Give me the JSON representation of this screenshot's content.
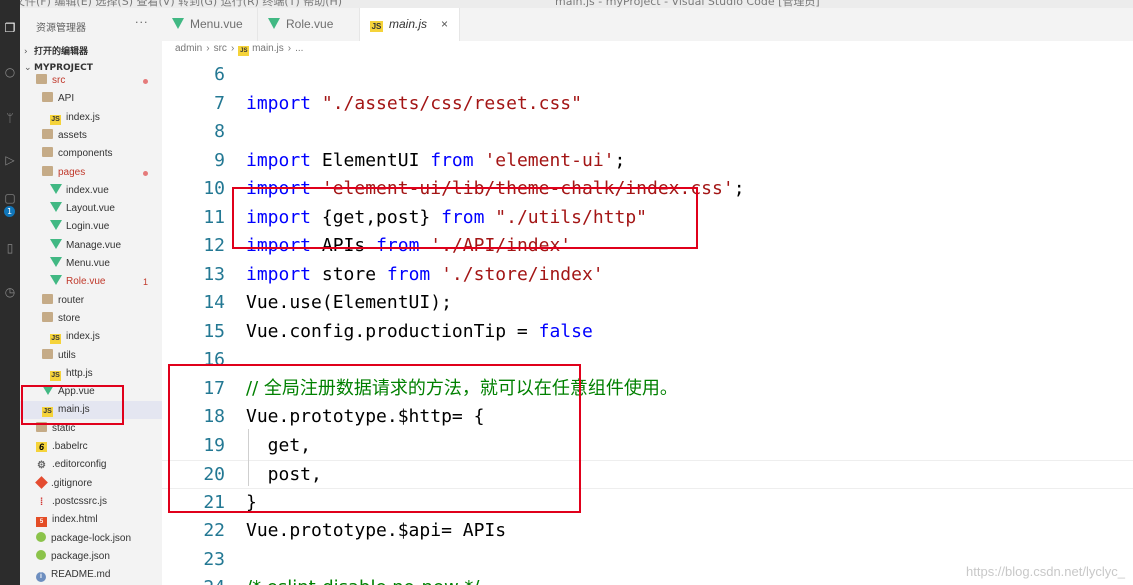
{
  "titlebar": {
    "menu_cut": "文件(F)  编辑(E)  选择(S)  查看(V)  转到(G)  运行(R)  终端(T)  帮助(H)",
    "window_title_cut": "main.js - myProject - Visual Studio Code [管理员]"
  },
  "activity_bar": {
    "icons": [
      "files-icon",
      "search-icon",
      "source-control-icon",
      "run-icon",
      "extensions-icon",
      "remote-icon",
      "timeline-icon"
    ],
    "badge": "1"
  },
  "sidebar": {
    "title": "资源管理器",
    "more": "···",
    "open_editors": "打开的编辑器",
    "project": "MYPROJECT",
    "items": [
      {
        "label": "src",
        "icon": "folder",
        "modified": true,
        "error": true
      },
      {
        "label": "API",
        "icon": "folder"
      },
      {
        "label": "index.js",
        "icon": "js"
      },
      {
        "label": "assets",
        "icon": "folder"
      },
      {
        "label": "components",
        "icon": "folder"
      },
      {
        "label": "pages",
        "icon": "folder",
        "modified": true,
        "error": true
      },
      {
        "label": "index.vue",
        "icon": "vue"
      },
      {
        "label": "Layout.vue",
        "icon": "vue"
      },
      {
        "label": "Login.vue",
        "icon": "vue"
      },
      {
        "label": "Manage.vue",
        "icon": "vue"
      },
      {
        "label": "Menu.vue",
        "icon": "vue"
      },
      {
        "label": "Role.vue",
        "icon": "vue",
        "error": true,
        "count": "1"
      },
      {
        "label": "router",
        "icon": "folder"
      },
      {
        "label": "store",
        "icon": "folder"
      },
      {
        "label": "index.js",
        "icon": "js"
      },
      {
        "label": "utils",
        "icon": "folder"
      },
      {
        "label": "http.js",
        "icon": "js"
      },
      {
        "label": "App.vue",
        "icon": "vue"
      },
      {
        "label": "main.js",
        "icon": "js",
        "active": true
      },
      {
        "label": "static",
        "icon": "folder"
      },
      {
        "label": ".babelrc",
        "icon": "babel"
      },
      {
        "label": ".editorconfig",
        "icon": "cfg"
      },
      {
        "label": ".gitignore",
        "icon": "git"
      },
      {
        "label": ".postcssrc.js",
        "icon": "post"
      },
      {
        "label": "index.html",
        "icon": "html"
      },
      {
        "label": "package-lock.json",
        "icon": "npm"
      },
      {
        "label": "package.json",
        "icon": "npm"
      },
      {
        "label": "README.md",
        "icon": "info"
      }
    ]
  },
  "tabs": [
    {
      "label": "Menu.vue",
      "icon": "vue",
      "active": false
    },
    {
      "label": "Role.vue",
      "icon": "vue",
      "active": false
    },
    {
      "label": "main.js",
      "icon": "js",
      "active": true,
      "close": "×"
    }
  ],
  "breadcrumb": {
    "parts": [
      "admin",
      "src",
      "main.js",
      "..."
    ]
  },
  "editor": {
    "lines": [
      {
        "n": "6",
        "html": ""
      },
      {
        "n": "7",
        "html": "<span class='kw'>import</span> <span class='str'>\"./assets/css/reset.css\"</span>"
      },
      {
        "n": "8",
        "html": ""
      },
      {
        "n": "9",
        "html": "<span class='kw'>import</span> ElementUI <span class='kw'>from</span> <span class='str'>'element-ui'</span>;"
      },
      {
        "n": "10",
        "html": "<span class='kw'>import</span> <span class='str'>'element-ui/lib/theme-chalk/index.css'</span>;"
      },
      {
        "n": "11",
        "html": "<span class='kw'>import</span> {get,post} <span class='kw'>from</span> <span class='str'>\"./utils/http\"</span>"
      },
      {
        "n": "12",
        "html": "<span class='kw'>import</span> APIs <span class='kw'>from</span> <span class='str'>'./API/index'</span>"
      },
      {
        "n": "13",
        "html": "<span class='kw'>import</span> store <span class='kw'>from</span> <span class='str'>'./store/index'</span>"
      },
      {
        "n": "14",
        "html": "Vue.use(ElementUI);"
      },
      {
        "n": "15",
        "html": "Vue.config.productionTip = <span class='bool'>false</span>"
      },
      {
        "n": "16",
        "html": ""
      },
      {
        "n": "17",
        "html": "<span class='cmt'>// 全局注册数据请求的方法，就可以在任意组件使用。</span>"
      },
      {
        "n": "18",
        "html": "Vue.prototype.$http= {"
      },
      {
        "n": "19",
        "html": "  get,"
      },
      {
        "n": "20",
        "html": "  post,"
      },
      {
        "n": "21",
        "html": "}"
      },
      {
        "n": "22",
        "html": "Vue.prototype.$api= APIs"
      },
      {
        "n": "23",
        "html": ""
      },
      {
        "n": "24",
        "html": "<span class='cmt'>/* eslint-disable no-new */</span>"
      }
    ]
  },
  "watermark": "https://blog.csdn.net/lyclyc_"
}
